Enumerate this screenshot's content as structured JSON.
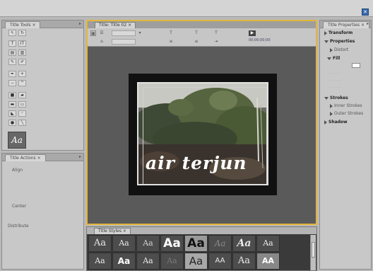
{
  "title_tools": {
    "tab": "Title Tools"
  },
  "title_actions": {
    "tab": "Title Actions",
    "sections": [
      "Align",
      "Center",
      "Distribute"
    ]
  },
  "editor": {
    "tab": "Title: Title 02",
    "toolbar": {
      "show_bg_video": "00;00;00;00"
    },
    "title_text": "air terjun"
  },
  "properties": {
    "tab": "Title Properties",
    "rows": [
      {
        "label": "Transform",
        "bold": true,
        "expanded": false
      },
      {
        "label": "Properties",
        "bold": true,
        "expanded": true
      },
      {
        "label": "Distort",
        "bold": false,
        "expanded": false
      },
      {
        "label": "Fill",
        "bold": true,
        "expanded": true
      },
      {
        "label": "Strokes",
        "bold": true,
        "expanded": true
      },
      {
        "label": "Inner Strokes",
        "bold": false,
        "expanded": false
      },
      {
        "label": "Outer Strokes",
        "bold": false,
        "expanded": false
      },
      {
        "label": "Shadow",
        "bold": true,
        "expanded": false
      }
    ],
    "fill_color": "#ffffff"
  },
  "styles": {
    "tab": "Title Styles",
    "row1": [
      "Aa",
      "Aa",
      "Aa",
      "Aa",
      "Aa",
      "Aa",
      "Aa",
      "Aa"
    ],
    "row2": [
      "Aa",
      "Aa",
      "Aa",
      "Aa",
      "Aa",
      "AA",
      "Aa",
      "AA"
    ]
  },
  "colors": {
    "accent": "#e4b53a",
    "panel": "#c8c8c8",
    "close": "#3a69a8"
  }
}
